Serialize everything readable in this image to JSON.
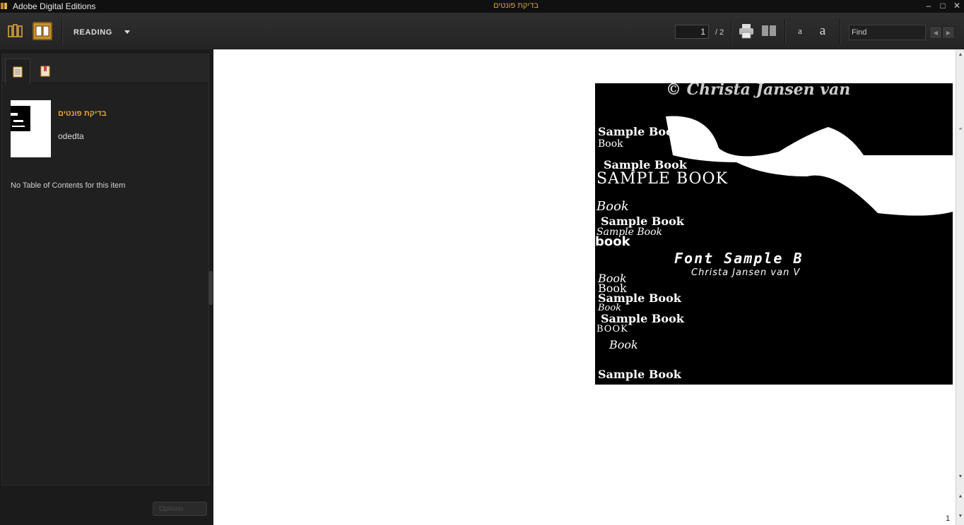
{
  "window": {
    "app_title": "Adobe Digital Editions",
    "doc_title": "בדיקת פונטים",
    "controls": [
      "–",
      "□",
      "✕"
    ]
  },
  "toolbar": {
    "view_label": "READING",
    "current_page": "1",
    "page_total": "/ 2",
    "find_placeholder": "Find",
    "font_small": "a",
    "font_large": "a"
  },
  "sidebar": {
    "book": {
      "title": "בדיקת פונטים",
      "author": "odedta"
    },
    "toc_message": "No Table of Contents for this item",
    "options_label": "Options"
  },
  "page": {
    "number": "1",
    "image_texts": [
      "© Christa Jansen van",
      "Sample Book",
      "Book",
      "Sample Book",
      "SAMPLE BOOK",
      "Book",
      "Sample Book",
      "Sample Book",
      "book",
      "Font Sample B",
      "Christa Jansen van V",
      "Book",
      "Book",
      "Sample Book",
      "Book",
      "Sample Book",
      "BOOK",
      "Book",
      "Sample Book"
    ]
  },
  "colors": {
    "accent": "#c9922e",
    "title_orange": "#e3a73d"
  }
}
